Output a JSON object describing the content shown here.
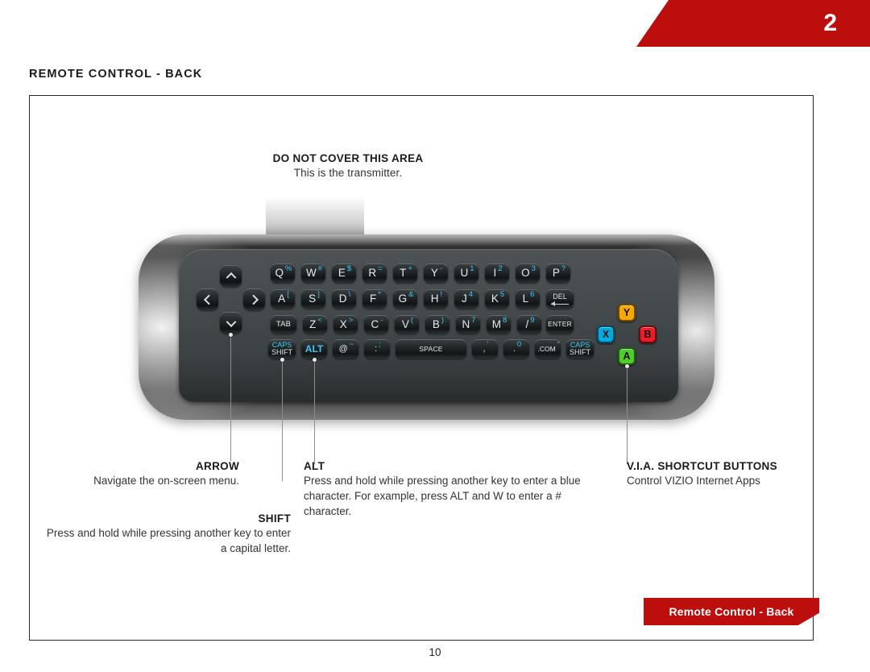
{
  "header": {
    "chapter_number": "2",
    "section_title": "REMOTE CONTROL - BACK"
  },
  "transmitter_note": {
    "heading": "DO NOT COVER THIS AREA",
    "body": "This is the transmitter."
  },
  "keyboard": {
    "row1": [
      {
        "main": "Q",
        "alt": "%"
      },
      {
        "main": "W",
        "alt": "#"
      },
      {
        "main": "E",
        "alt": "$"
      },
      {
        "main": "R",
        "alt": "="
      },
      {
        "main": "T",
        "alt": "+"
      },
      {
        "main": "Y",
        "alt": "-"
      },
      {
        "main": "U",
        "alt": "1"
      },
      {
        "main": "I",
        "alt": "2"
      },
      {
        "main": "O",
        "alt": "3"
      },
      {
        "main": "P",
        "alt": "?"
      }
    ],
    "row2": [
      {
        "main": "A",
        "alt": "["
      },
      {
        "main": "S",
        "alt": "]"
      },
      {
        "main": "D",
        "alt": "\\"
      },
      {
        "main": "F",
        "alt": "*"
      },
      {
        "main": "G",
        "alt": "&"
      },
      {
        "main": "H",
        "alt": "!"
      },
      {
        "main": "J",
        "alt": "4"
      },
      {
        "main": "K",
        "alt": "5"
      },
      {
        "main": "L",
        "alt": "6"
      },
      {
        "main": "DEL",
        "alt": ""
      }
    ],
    "row3": [
      {
        "main": "TAB",
        "alt": ""
      },
      {
        "main": "Z",
        "alt": "<"
      },
      {
        "main": "X",
        "alt": ">"
      },
      {
        "main": "C",
        "alt": "-"
      },
      {
        "main": "V",
        "alt": "("
      },
      {
        "main": "B",
        "alt": ")"
      },
      {
        "main": "N",
        "alt": "7"
      },
      {
        "main": "M",
        "alt": "8"
      },
      {
        "main": "/",
        "alt": "9"
      },
      {
        "main": "ENTER",
        "alt": ""
      }
    ],
    "row4": [
      {
        "main": "SHIFT",
        "alt": "CAPS"
      },
      {
        "main": "ALT",
        "alt": ""
      },
      {
        "main": "@",
        "alt": "~"
      },
      {
        "main": ":",
        "alt": ";"
      },
      {
        "main": "SPACE",
        "alt": ""
      },
      {
        "main": ",",
        "alt": "'"
      },
      {
        "main": ".",
        "alt": "0"
      },
      {
        "main": ".COM",
        "alt": "\""
      },
      {
        "main": "SHIFT",
        "alt": "CAPS"
      }
    ],
    "alt_key_color": "#3fc6f2"
  },
  "nav_pad": {
    "up": "up-arrow",
    "down": "down-arrow",
    "left": "left-arrow",
    "right": "right-arrow"
  },
  "via_buttons": [
    {
      "label": "Y",
      "color": "#f5a800"
    },
    {
      "label": "X",
      "color": "#00a9e0"
    },
    {
      "label": "B",
      "color": "#ee1c25"
    },
    {
      "label": "A",
      "color": "#4fcd2a"
    }
  ],
  "callouts": {
    "arrow": {
      "heading": "ARROW",
      "body": "Navigate the on-screen menu."
    },
    "shift": {
      "heading": "SHIFT",
      "body": "Press and hold while pressing another key to enter a capital letter."
    },
    "alt": {
      "heading": "ALT",
      "body": "Press and hold while pressing another key to enter a blue character. For example, press ALT and W to enter a # character."
    },
    "via": {
      "heading": "V.I.A. SHORTCUT BUTTONS",
      "body": "Control VIZIO Internet Apps"
    }
  },
  "footer": {
    "tag_label": "Remote Control - Back",
    "page_number": "10"
  },
  "colors": {
    "brand_red": "#bd0e0e",
    "blue_alt": "#3fc6f2"
  }
}
